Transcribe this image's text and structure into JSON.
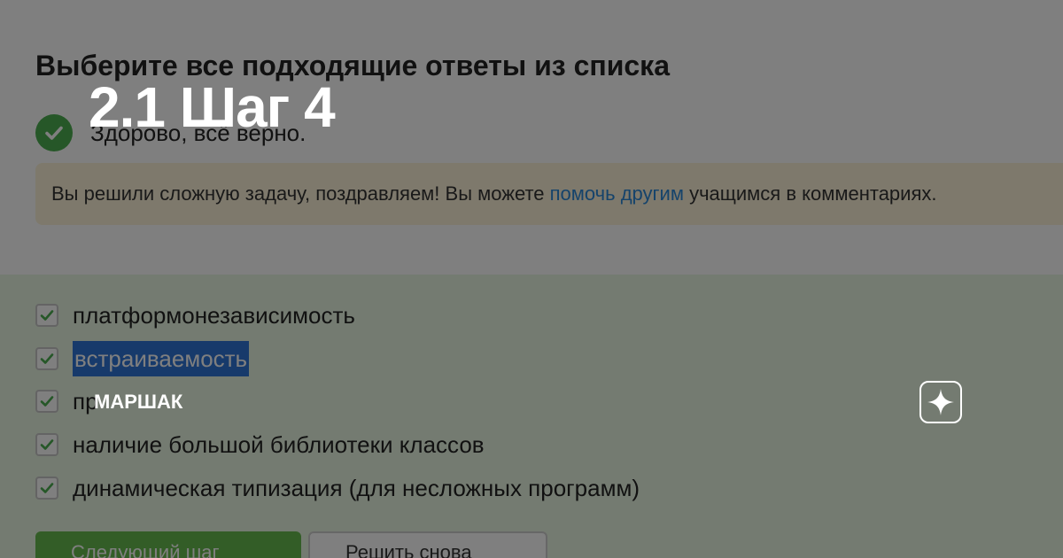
{
  "card": {
    "title": "2.1 Шаг 4",
    "brand": "МАРШАК"
  },
  "task": {
    "heading": "Выберите все подходящие ответы из списка",
    "success_text": "Здорово, всё верно.",
    "notice": {
      "before": "Вы решили сложную задачу, поздравляем! Вы можете ",
      "link": "помочь другим",
      "after": " учащимся в комментариях."
    }
  },
  "options": [
    {
      "label": "платформонезависимость",
      "checked": true
    },
    {
      "label": "встраиваемость",
      "checked": true,
      "highlighted": true
    },
    {
      "label": "пр",
      "checked": true
    },
    {
      "label": "наличие большой библиотеки классов",
      "checked": true
    },
    {
      "label": "динамическая типизация (для несложных программ)",
      "checked": true
    }
  ],
  "buttons": {
    "next": "Следующий шаг",
    "solve_again": "Решить снова"
  },
  "icons": {
    "success": "check-circle-icon",
    "option_check": "checkmark-icon",
    "logo": "sparkle-star-icon"
  },
  "colors": {
    "success_green": "#4caf50",
    "link_blue": "#2a86d6",
    "selection_blue": "#2e74d6",
    "answer_bg": "#e9f7e3",
    "notice_bg": "#fdf3d8"
  }
}
